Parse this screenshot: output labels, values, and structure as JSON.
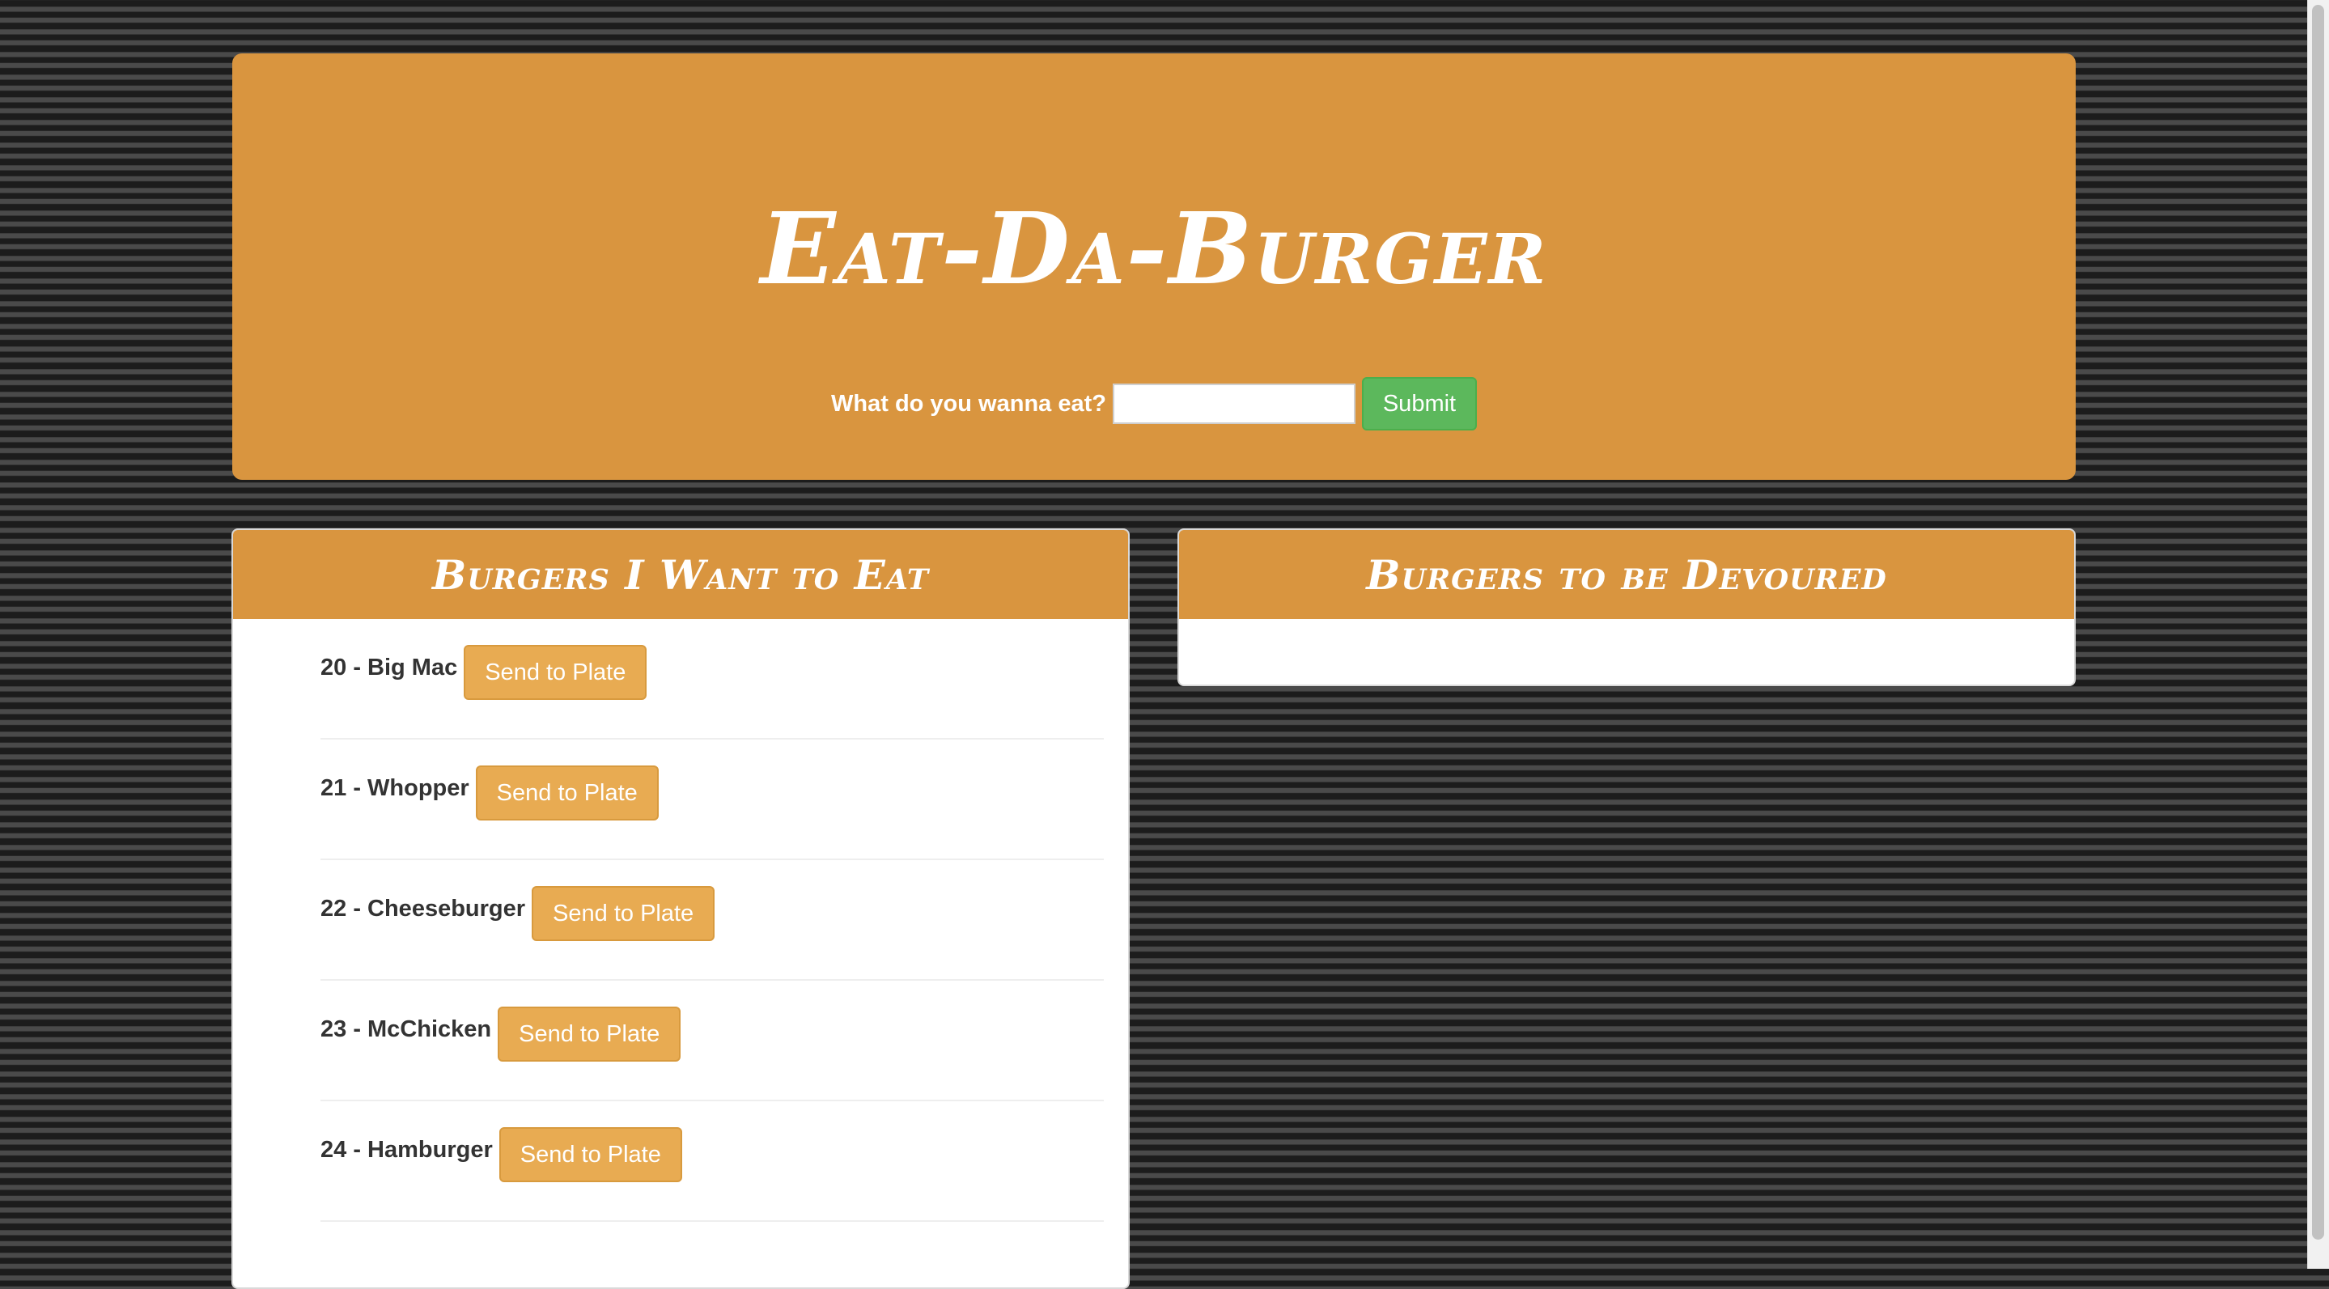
{
  "header": {
    "title": "Eat-Da-Burger",
    "form_label": "What do you wanna eat?",
    "input_value": "",
    "submit_label": "Submit"
  },
  "left_panel": {
    "title": "Burgers I Want to Eat",
    "items": [
      {
        "label": "20 - Big Mac",
        "button": "Send to Plate"
      },
      {
        "label": "21 - Whopper",
        "button": "Send to Plate"
      },
      {
        "label": "22 - Cheeseburger",
        "button": "Send to Plate"
      },
      {
        "label": "23 - McChicken",
        "button": "Send to Plate"
      },
      {
        "label": "24 - Hamburger",
        "button": "Send to Plate"
      }
    ]
  },
  "right_panel": {
    "title": "Burgers to be Devoured",
    "items": []
  },
  "colors": {
    "accent": "#d9953f",
    "button": "#e8ab52",
    "submit": "#5cb85c"
  }
}
